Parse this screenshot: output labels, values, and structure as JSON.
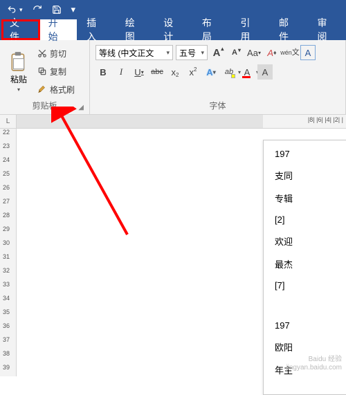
{
  "qat": {
    "undo": "↶",
    "redo_icon": "redo",
    "save_icon": "save",
    "custom": "▾"
  },
  "tabs": {
    "file": "文件",
    "home": "开始",
    "insert": "插入",
    "draw": "绘图",
    "design": "设计",
    "layout": "布局",
    "references": "引用",
    "mailings": "邮件",
    "review": "审阅"
  },
  "clipboard": {
    "paste": "粘贴",
    "cut": "剪切",
    "copy": "复制",
    "format_painter": "格式刷",
    "group_label": "剪贴板"
  },
  "font": {
    "name": "等线 (中文正文",
    "size": "五号",
    "grow": "A",
    "shrink": "A",
    "case": "Aa",
    "clear": "A",
    "pinyin": "wén",
    "charborder": "A",
    "bold": "B",
    "italic": "I",
    "underline": "U",
    "strike": "abc",
    "sub_x": "x",
    "sub_2": "2",
    "sup_x": "x",
    "sup_2": "2",
    "texteffect": "A",
    "highlight": "ab",
    "fontcolor": "A",
    "charshade": "A",
    "group_label": "字体"
  },
  "hruler_ticks": "|8|  |6|  |4|  |2|  |",
  "vruler_ticks": [
    "22",
    "23",
    "24",
    "25",
    "26",
    "27",
    "28",
    "29",
    "30",
    "31",
    "32",
    "33",
    "34",
    "35",
    "36",
    "37",
    "38",
    "39"
  ],
  "document": {
    "lines": [
      "197",
      "支同",
      "专辑",
      "[2]",
      "欢迎",
      "最杰",
      "[7]",
      "",
      "197",
      "欧阳",
      "年主"
    ]
  },
  "watermark": {
    "l1": "Baidu 经验",
    "l2": "jingyan.baidu.com"
  },
  "corner": "L"
}
